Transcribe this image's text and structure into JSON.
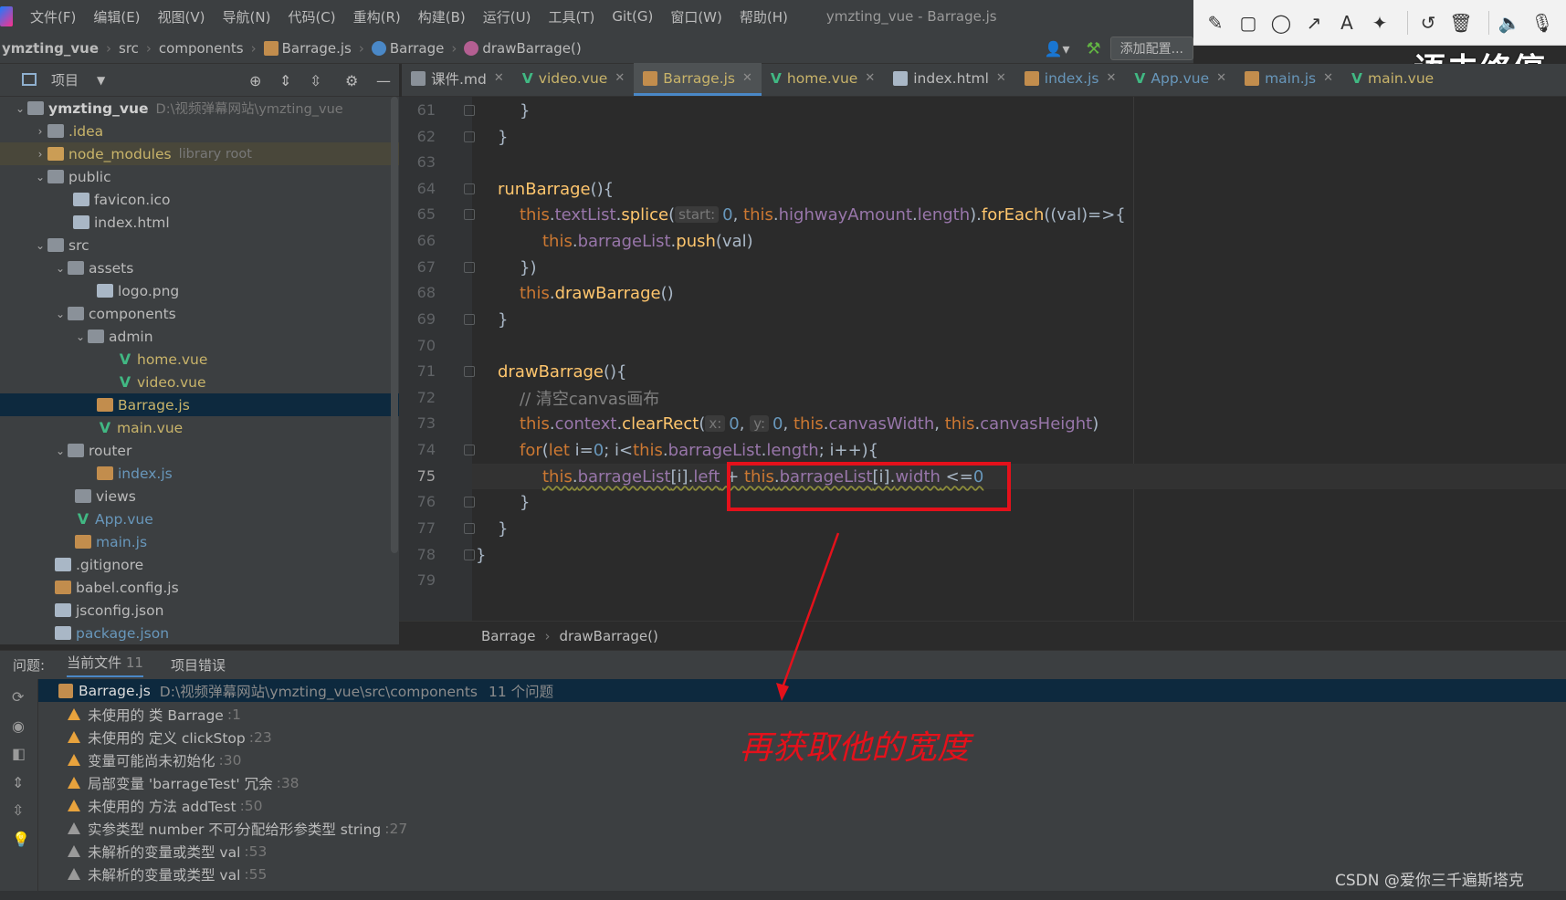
{
  "menubar": {
    "items": [
      "文件(F)",
      "编辑(E)",
      "视图(V)",
      "导航(N)",
      "代码(C)",
      "重构(R)",
      "构建(B)",
      "运行(U)",
      "工具(T)",
      "Git(G)",
      "窗口(W)",
      "帮助(H)"
    ],
    "window_title": "ymzting_vue - Barrage.js"
  },
  "annotation_toolbar": {
    "tools": [
      "pencil-icon",
      "rectangle-icon",
      "ellipse-icon",
      "arrow-icon",
      "text-icon",
      "magic-wand-icon",
      "undo-icon",
      "delete-icon",
      "speaker-icon",
      "mic-icon"
    ]
  },
  "navbar": {
    "crumbs": [
      "ymzting_vue",
      "src",
      "components",
      "Barrage.js",
      "Barrage",
      "drawBarrage()"
    ],
    "add_config": "添加配置...",
    "git_label": "Git(G):"
  },
  "watermark": "语未终停",
  "project": {
    "title": "项目",
    "tree": [
      {
        "label": "ymzting_vue",
        "hint": "D:\\视频弹幕网站\\ymzting_vue"
      },
      {
        "label": ".idea"
      },
      {
        "label": "node_modules",
        "hint": "library root"
      },
      {
        "label": "public"
      },
      {
        "label": "favicon.ico"
      },
      {
        "label": "index.html"
      },
      {
        "label": "src"
      },
      {
        "label": "assets"
      },
      {
        "label": "logo.png"
      },
      {
        "label": "components"
      },
      {
        "label": "admin"
      },
      {
        "label": "home.vue"
      },
      {
        "label": "video.vue"
      },
      {
        "label": "Barrage.js"
      },
      {
        "label": "main.vue"
      },
      {
        "label": "router"
      },
      {
        "label": "index.js"
      },
      {
        "label": "views"
      },
      {
        "label": "App.vue"
      },
      {
        "label": "main.js"
      },
      {
        "label": ".gitignore"
      },
      {
        "label": "babel.config.js"
      },
      {
        "label": "jsconfig.json"
      },
      {
        "label": "package.json"
      }
    ]
  },
  "tabs": [
    {
      "label": "课件.md"
    },
    {
      "label": "video.vue"
    },
    {
      "label": "Barrage.js"
    },
    {
      "label": "home.vue"
    },
    {
      "label": "index.html"
    },
    {
      "label": "index.js"
    },
    {
      "label": "App.vue"
    },
    {
      "label": "main.js"
    },
    {
      "label": "main.vue"
    }
  ],
  "editor": {
    "line_numbers": [
      "61",
      "62",
      "63",
      "64",
      "65",
      "66",
      "67",
      "68",
      "69",
      "70",
      "71",
      "72",
      "73",
      "74",
      "75",
      "76",
      "77",
      "78",
      "79"
    ],
    "code": {
      "l61": "}",
      "l62": "}",
      "l64_fn": "runBarrage",
      "l64_rest": "(){",
      "l65_this": "this",
      "l65_a": ".",
      "l65_prop": "textList",
      "l65_b": ".",
      "l65_fn": "splice",
      "l65_c": "(",
      "l65_hint": "start:",
      "l65_num": "0",
      "l65_d": ", ",
      "l65_this2": "this",
      "l65_e": ".",
      "l65_prop2": "highwayAmount",
      "l65_f": ".",
      "l65_prop3": "length",
      "l65_g": ").",
      "l65_fn2": "forEach",
      "l65_h": "((val)=>{",
      "l66_this": "this",
      "l66_a": ".",
      "l66_prop": "barrageList",
      "l66_b": ".",
      "l66_fn": "push",
      "l66_c": "(val)",
      "l67": "})",
      "l68_this": "this",
      "l68_a": ".",
      "l68_fn": "drawBarrage",
      "l68_b": "()",
      "l69": "}",
      "l71_fn": "drawBarrage",
      "l71_rest": "(){",
      "l72_cmt": "// 清空canvas画布",
      "l73_this": "this",
      "l73_a": ".",
      "l73_prop": "context",
      "l73_b": ".",
      "l73_fn": "clearRect",
      "l73_c": "(",
      "l73_hint1": "x:",
      "l73_num1": "0",
      "l73_d": ", ",
      "l73_hint2": "y:",
      "l73_num2": "0",
      "l73_e": ", ",
      "l73_this2": "this",
      "l73_f": ".",
      "l73_prop2": "canvasWidth",
      "l73_g": ", ",
      "l73_this3": "this",
      "l73_h": ".",
      "l73_prop3": "canvasHeight",
      "l73_i": ")",
      "l74_kw": "for",
      "l74_a": "(",
      "l74_kw2": "let",
      "l74_b": " i=",
      "l74_num": "0",
      "l74_c": "; i<",
      "l74_this": "this",
      "l74_d": ".",
      "l74_prop": "barrageList",
      "l74_e": ".",
      "l74_prop2": "length",
      "l74_f": "; i++){",
      "l75_this": "this",
      "l75_a": ".",
      "l75_prop": "barrageList",
      "l75_b": "[i].",
      "l75_prop2": "left",
      "l75_c": " + ",
      "l75_this2": "this",
      "l75_d": ".",
      "l75_prop3": "barrageList",
      "l75_e": "[i].",
      "l75_prop4": "width",
      "l75_f": " <=",
      "l75_num": "0",
      "l76": "}",
      "l77": "}",
      "l78": "}"
    },
    "breadcrumb": [
      "Barrage",
      "drawBarrage()"
    ]
  },
  "problems": {
    "tab_problems": "问题:",
    "tab_current_file": "当前文件",
    "current_file_count": "11",
    "tab_project_errors": "项目错误",
    "file": "Barrage.js",
    "file_path": "D:\\视频弹幕网站\\ymzting_vue\\src\\components",
    "file_count": "11 个问题",
    "items": [
      {
        "text": "未使用的 类 Barrage",
        "line": ":1",
        "level": "warn"
      },
      {
        "text": "未使用的 定义 clickStop",
        "line": ":23",
        "level": "warn"
      },
      {
        "text": "变量可能尚未初始化",
        "line": ":30",
        "level": "warn"
      },
      {
        "text": "局部变量 'barrageTest' 冗余",
        "line": ":38",
        "level": "warn"
      },
      {
        "text": "未使用的 方法 addTest",
        "line": ":50",
        "level": "warn"
      },
      {
        "text": "实参类型 number 不可分配给形参类型 string",
        "line": ":27",
        "level": "weak"
      },
      {
        "text": "未解析的变量或类型 val",
        "line": ":53",
        "level": "weak"
      },
      {
        "text": "未解析的变量或类型 val",
        "line": ":55",
        "level": "weak"
      }
    ]
  },
  "annotation": {
    "text": "再获取他的宽度",
    "color": "#e4111b"
  },
  "credit": "CSDN @爱你三千遍斯塔克"
}
